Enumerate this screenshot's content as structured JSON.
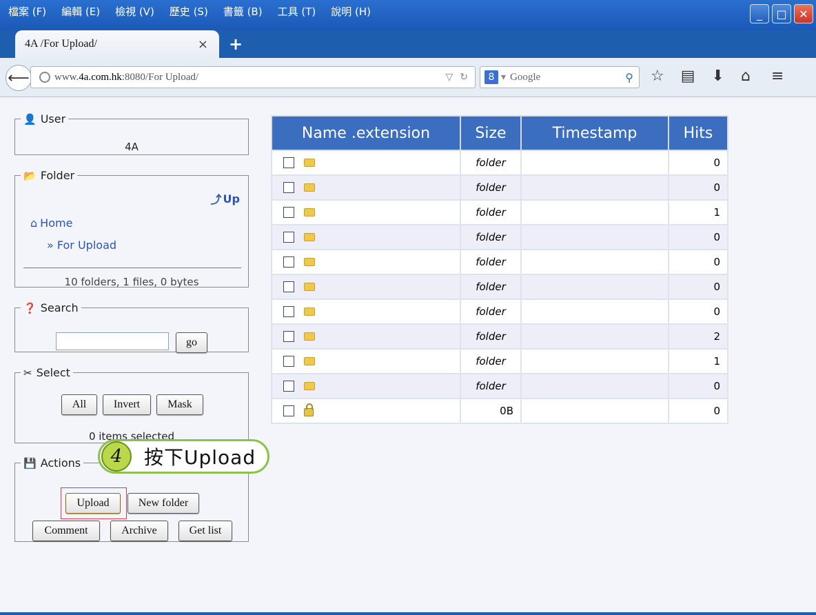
{
  "menu": [
    "檔案 (F)",
    "編輯 (E)",
    "檢視 (V)",
    "歷史 (S)",
    "書籤 (B)",
    "工具 (T)",
    "說明 (H)"
  ],
  "tab": {
    "title": "4A /For Upload/",
    "close": "×",
    "new_tab": "+"
  },
  "address": {
    "prefix": "www.",
    "host": "4a.com.hk",
    "rest": ":8080/For Upload/"
  },
  "search_engine": {
    "placeholder": "Google",
    "logo": "8"
  },
  "sidebar": {
    "user": {
      "legend": "User",
      "name": "4A"
    },
    "folder": {
      "legend": "Folder",
      "up": "Up",
      "home": "Home",
      "current": "» For Upload",
      "stats": "10 folders, 1 files, 0 bytes"
    },
    "search": {
      "legend": "Search",
      "input_value": "",
      "go": "go"
    },
    "select": {
      "legend": "Select",
      "all": "All",
      "invert": "Invert",
      "mask": "Mask",
      "count": "0 items selected"
    },
    "actions": {
      "legend": "Actions",
      "upload": "Upload",
      "new_folder": "New folder",
      "comment": "Comment",
      "archive": "Archive",
      "get_list": "Get list"
    }
  },
  "callout": {
    "number": "4",
    "text": "按下Upload"
  },
  "file_table": {
    "headers": [
      "Name .extension",
      "Size",
      "Timestamp",
      "Hits"
    ],
    "rows": [
      {
        "type": "folder",
        "name": "",
        "size": "folder",
        "timestamp": "",
        "hits": "0"
      },
      {
        "type": "folder",
        "name": "",
        "size": "folder",
        "timestamp": "",
        "hits": "0"
      },
      {
        "type": "folder",
        "name": "",
        "size": "folder",
        "timestamp": "",
        "hits": "1"
      },
      {
        "type": "folder",
        "name": "",
        "size": "folder",
        "timestamp": "",
        "hits": "0"
      },
      {
        "type": "folder",
        "name": "",
        "size": "folder",
        "timestamp": "",
        "hits": "0"
      },
      {
        "type": "folder",
        "name": "",
        "size": "folder",
        "timestamp": "",
        "hits": "0"
      },
      {
        "type": "folder",
        "name": "",
        "size": "folder",
        "timestamp": "",
        "hits": "0"
      },
      {
        "type": "folder",
        "name": "",
        "size": "folder",
        "timestamp": "",
        "hits": "2"
      },
      {
        "type": "folder",
        "name": "",
        "size": "folder",
        "timestamp": "",
        "hits": "1"
      },
      {
        "type": "folder",
        "name": "",
        "size": "folder",
        "timestamp": "",
        "hits": "0"
      },
      {
        "type": "file-locked",
        "name": "",
        "size": "0B",
        "timestamp": "",
        "hits": "0"
      }
    ]
  }
}
